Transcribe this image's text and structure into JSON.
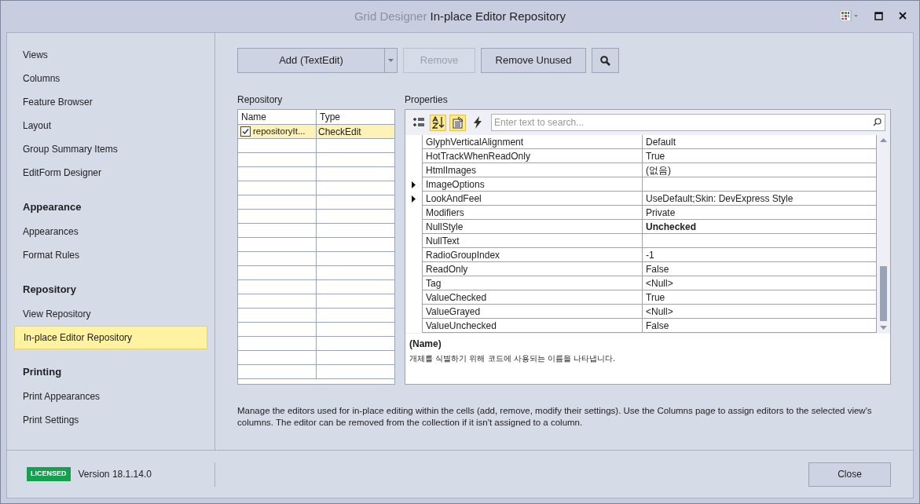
{
  "window": {
    "title_dim": "Grid Designer",
    "title": "In-place Editor Repository"
  },
  "sidebar": {
    "groups": [
      {
        "items": [
          {
            "label": "Views",
            "selected": false
          },
          {
            "label": "Columns",
            "selected": false
          },
          {
            "label": "Feature Browser",
            "selected": false
          },
          {
            "label": "Layout",
            "selected": false
          },
          {
            "label": "Group Summary Items",
            "selected": false
          },
          {
            "label": "EditForm Designer",
            "selected": false
          }
        ]
      },
      {
        "header": "Appearance",
        "items": [
          {
            "label": "Appearances",
            "selected": false
          },
          {
            "label": "Format Rules",
            "selected": false
          }
        ]
      },
      {
        "header": "Repository",
        "items": [
          {
            "label": "View Repository",
            "selected": false
          },
          {
            "label": "In-place Editor Repository",
            "selected": true
          }
        ]
      },
      {
        "header": "Printing",
        "items": [
          {
            "label": "Print Appearances",
            "selected": false
          },
          {
            "label": "Print Settings",
            "selected": false
          }
        ]
      }
    ]
  },
  "toolbar": {
    "add": "Add (TextEdit)",
    "remove": {
      "label": "Remove",
      "disabled": true
    },
    "remove_unused": {
      "label": "Remove Unused",
      "disabled": false
    }
  },
  "repository": {
    "title": "Repository",
    "columns": [
      "Name",
      "Type"
    ],
    "rows": [
      {
        "name": "repositoryIt...",
        "type": "CheckEdit",
        "checked": true,
        "selected": true
      }
    ]
  },
  "properties": {
    "title": "Properties",
    "search_placeholder": "Enter text to search...",
    "tools": [
      {
        "kind": "categorized",
        "selected": false
      },
      {
        "kind": "alphabetical",
        "selected": true
      },
      {
        "kind": "properties",
        "selected": true
      },
      {
        "kind": "events",
        "selected": false
      }
    ],
    "rows": [
      {
        "name": "GlyphVerticalAlignment",
        "value": "Default",
        "expandable": false,
        "modified": false
      },
      {
        "name": "HotTrackWhenReadOnly",
        "value": "True",
        "expandable": false,
        "modified": false
      },
      {
        "name": "HtmlImages",
        "value": "(없음)",
        "expandable": false,
        "modified": false
      },
      {
        "name": "ImageOptions",
        "value": "",
        "expandable": true
      },
      {
        "name": "LookAndFeel",
        "value": "UseDefault;Skin: DevExpress Style",
        "expandable": true,
        "modified": false
      },
      {
        "name": "Modifiers",
        "value": "Private",
        "expandable": false,
        "modified": false
      },
      {
        "name": "NullStyle",
        "value": "Unchecked",
        "expandable": false,
        "modified": true
      },
      {
        "name": "NullText",
        "value": "",
        "expandable": false
      },
      {
        "name": "RadioGroupIndex",
        "value": "-1",
        "expandable": false,
        "modified": false
      },
      {
        "name": "ReadOnly",
        "value": "False",
        "expandable": false,
        "modified": false
      },
      {
        "name": "Tag",
        "value": "<Null>",
        "expandable": false,
        "modified": false
      },
      {
        "name": "ValueChecked",
        "value": "True",
        "expandable": false,
        "modified": false
      },
      {
        "name": "ValueGrayed",
        "value": "<Null>",
        "expandable": false,
        "modified": false
      },
      {
        "name": "ValueUnchecked",
        "value": "False",
        "expandable": false,
        "modified": false
      }
    ],
    "description_title": "(Name)",
    "description": "개체를 식별하기 위해 코드에 사용되는 이름을 나타냅니다."
  },
  "help_text": "Manage the editors used for in-place editing within the cells (add, remove, modify their settings). Use the Columns page to assign editors to the selected view's columns. The editor can be removed from the collection if it isn't assigned to a column.",
  "footer": {
    "badge": "LICENSED",
    "version": "Version 18.1.14.0",
    "close": "Close"
  }
}
